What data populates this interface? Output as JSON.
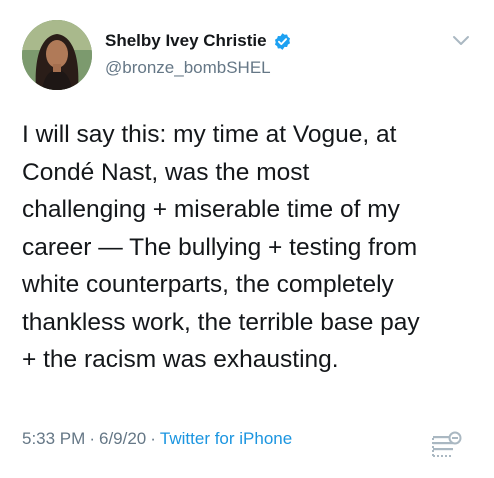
{
  "tweet": {
    "author": {
      "display_name": "Shelby Ivey Christie",
      "handle": "@bronze_bombSHEL",
      "verified": true
    },
    "text": "I will say this: my time at Vogue, at\nCondé Nast, was the most\nchallenging + miserable time of my\ncareer — The bullying + testing from\nwhite counterparts, the completely\nthankless work, the terrible base pay\n+ the racism was exhausting.",
    "time": "5:33 PM",
    "separator": "·",
    "date": "6/9/20",
    "source": "Twitter for iPhone"
  },
  "icons": {
    "verified": "verified-badge-icon",
    "menu": "chevron-down-icon",
    "analytics": "tweet-analytics-icon"
  },
  "colors": {
    "text": "#14171a",
    "secondary": "#657786",
    "link": "#1b95e0",
    "verified": "#1da1f2"
  }
}
